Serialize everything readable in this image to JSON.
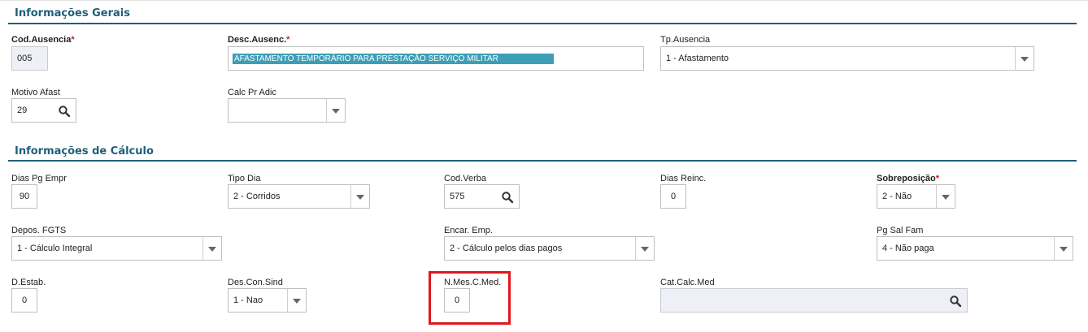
{
  "sections": {
    "general": "Informações Gerais",
    "calc": "Informações de Cálculo"
  },
  "fields": {
    "cod_ausencia": {
      "label": "Cod.Ausencia",
      "required": "*",
      "value": "005"
    },
    "desc_ausenc": {
      "label": "Desc.Ausenc.",
      "required": "*",
      "value": "AFASTAMENTO TEMPORÁRIO PARA PRESTAÇÃO SERVIÇO MILITAR"
    },
    "tp_ausencia": {
      "label": "Tp.Ausencia",
      "value": "1 - Afastamento"
    },
    "motivo_afast": {
      "label": "Motivo Afast",
      "value": "29"
    },
    "calc_pr_adic": {
      "label": "Calc Pr Adic",
      "value": ""
    },
    "dias_pg_empr": {
      "label": "Dias Pg Empr",
      "value": "90"
    },
    "tipo_dia": {
      "label": "Tipo Dia",
      "value": "2 - Corridos"
    },
    "cod_verba": {
      "label": "Cod.Verba",
      "value": "575"
    },
    "dias_reinc": {
      "label": "Dias Reinc.",
      "value": "0"
    },
    "sobreposicao": {
      "label": "Sobreposição",
      "required": "*",
      "value": "2 - Não"
    },
    "depos_fgts": {
      "label": "Depos. FGTS",
      "value": "1 - Cálculo Integral"
    },
    "encar_emp": {
      "label": "Encar. Emp.",
      "value": "2 - Cálculo pelos dias pagos"
    },
    "pg_sal_fam": {
      "label": "Pg Sal Fam",
      "value": "4 - Não paga"
    },
    "d_estab": {
      "label": "D.Estab.",
      "value": "0"
    },
    "des_con_sind": {
      "label": "Des.Con.Sind",
      "value": "1 - Nao"
    },
    "n_mes_c_med": {
      "label": "N.Mes.C.Med.",
      "value": "0"
    },
    "cat_calc_med": {
      "label": "Cat.Calc.Med",
      "value": ""
    }
  },
  "colors": {
    "section": "#1f5f7a",
    "required": "#d0201f",
    "highlight": "#3d9fb5",
    "annotation": "#e1171e"
  },
  "icons": {
    "search": "search-icon",
    "dropdown": "chevron-down-icon"
  }
}
